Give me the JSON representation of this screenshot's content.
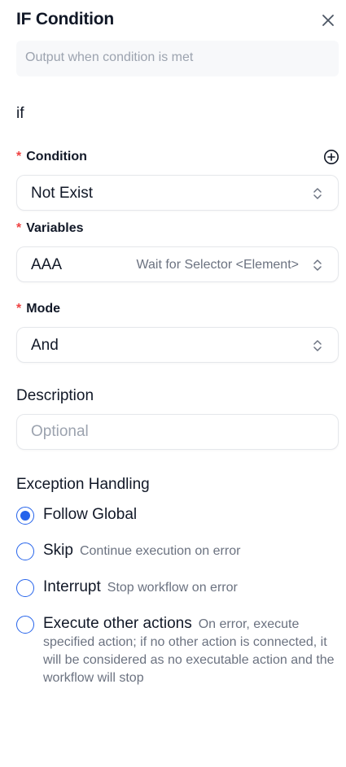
{
  "panel": {
    "title": "IF Condition",
    "output_placeholder": "Output when condition is met"
  },
  "if_label": "if",
  "condition": {
    "label": "Condition",
    "value": "Not Exist"
  },
  "variables": {
    "label": "Variables",
    "value": "AAA",
    "hint": "Wait for Selector <Element>"
  },
  "mode": {
    "label": "Mode",
    "value": "And"
  },
  "description": {
    "label": "Description",
    "placeholder": "Optional"
  },
  "exception": {
    "title": "Exception Handling",
    "options": [
      {
        "label": "Follow Global",
        "hint": "",
        "checked": true
      },
      {
        "label": "Skip",
        "hint": "Continue execution on error",
        "checked": false
      },
      {
        "label": "Interrupt",
        "hint": "Stop workflow on error",
        "checked": false
      },
      {
        "label": "Execute other actions",
        "hint": "On error, execute specified action; if no other action is connected, it will be considered as no executable action and the workflow will stop",
        "checked": false
      }
    ]
  },
  "colors": {
    "accent": "#2563eb",
    "required": "#ef4444"
  }
}
